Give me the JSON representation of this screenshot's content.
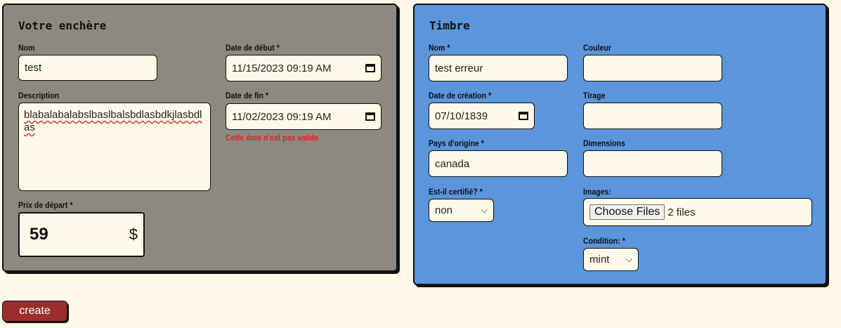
{
  "auction": {
    "title": "Votre enchère",
    "name_label": "Nom",
    "name_value": "test",
    "description_label": "Description",
    "description_value": "blabalabalabslbaslbalsbdlasbdkjlasbdlas",
    "start_label": "Date de début *",
    "start_value": "11/15/2023 09:19 AM",
    "end_label": "Date de fin *",
    "end_value": "11/02/2023 09:19 AM",
    "end_error": "Cette date n'est pas valide",
    "price_label": "Prix de départ *",
    "price_value": "59",
    "price_currency": "$"
  },
  "stamp": {
    "title": "Timbre",
    "name_label": "Nom *",
    "name_value": "test erreur",
    "color_label": "Couleur",
    "color_value": "",
    "creation_label": "Date de création *",
    "creation_value": "07/10/1839",
    "print_label": "Tirage",
    "print_value": "",
    "country_label": "Pays d'origine *",
    "country_value": "canada",
    "dimensions_label": "Dimensions",
    "dimensions_value": "",
    "certified_label": "Est-il certifié? *",
    "certified_value": "non",
    "images_label": "Images:",
    "images_button": "Choose Files",
    "images_status": "2 files",
    "condition_label": "Condition: *",
    "condition_value": "mint"
  },
  "actions": {
    "create_label": "create"
  },
  "colors": {
    "background": "#fef9e8",
    "auction_panel": "#8c8a80",
    "stamp_panel": "#5b95dc",
    "create_button": "#9b2d2d",
    "error_text": "#e81c1c"
  },
  "icons": [
    "calendar-icon",
    "chevron-down-icon"
  ]
}
